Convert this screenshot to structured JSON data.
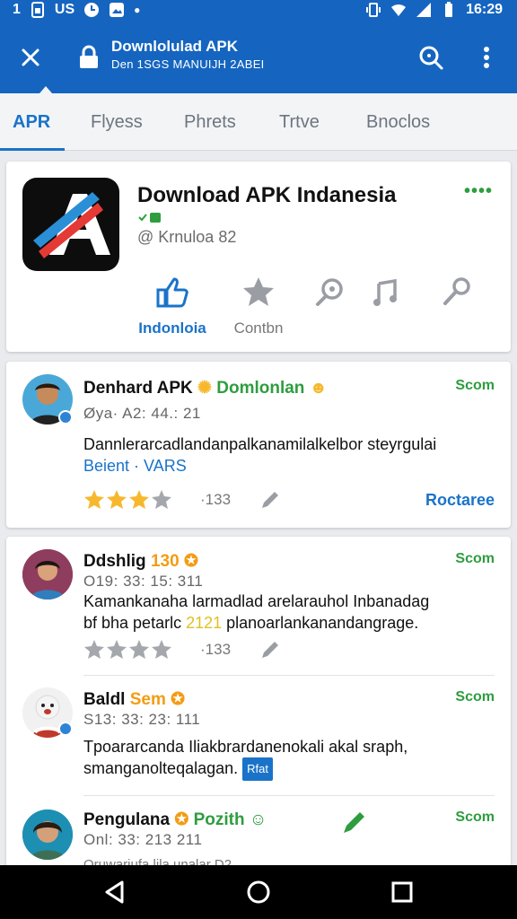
{
  "status_bar": {
    "left_text": "1",
    "left_text2": "US",
    "time": "16:29"
  },
  "app_bar": {
    "title": "Downlolulad APK",
    "subtitle": "Den 1SGS MANUIJH 2ABEI"
  },
  "tabs": [
    {
      "label": "APR",
      "active": true
    },
    {
      "label": "Flyess",
      "active": false
    },
    {
      "label": "Phrets",
      "active": false
    },
    {
      "label": "Trtve",
      "active": false
    },
    {
      "label": "Bnoclos",
      "active": false
    }
  ],
  "app_card": {
    "name": "Download APK Indanesia",
    "author": "@ Krnuloa 82",
    "menu": "••••",
    "actions": [
      {
        "icon": "thumbs-up-icon",
        "label": "Indonloia"
      },
      {
        "icon": "star-icon",
        "label": "Contbn"
      },
      {
        "icon": "search-icon",
        "label": ""
      },
      {
        "icon": "music-note-icon",
        "label": ""
      },
      {
        "icon": "microphone-icon",
        "label": ""
      }
    ]
  },
  "reviews": [
    {
      "name": "Denhard APK",
      "tag": "Domlonlan",
      "date": "Øya· A2: 44.: 21",
      "text1": "Dannlerarcadlandanpalkanamilalkelbor steyrgulai",
      "text2": "Beient · VARS",
      "seen": "Scom",
      "rating": 3,
      "count": "·133",
      "action": "Roctaree"
    },
    {
      "name": "Ddshlig",
      "tag": "130",
      "date": "O19: 33: 15: 311",
      "text1": "Kamankanaha larmadlad arelarauhol Inbanadag",
      "text2a": "bf bha petarlc ",
      "text2b": "2121",
      "text2c": " planoarlankanandangrage.",
      "seen": "Scom",
      "rating": 0,
      "count": "·133"
    },
    {
      "name": "Baldl",
      "tag": "Sem",
      "date": "S13: 33: 23: 111",
      "text1": "Tpoararcanda Iliakbrardanenokali akal sraph,",
      "text2": "smanganolteqalagan.",
      "chip": "Rfat",
      "seen": "Scom"
    },
    {
      "name": "Pengulana",
      "tag": "Pozith",
      "date": "Onl: 33: 213 211",
      "text3": "Oruwariufa lila unalar D2",
      "seen": "Scom"
    }
  ],
  "colors": {
    "primary": "#1565c0",
    "accent": "#1a73c8",
    "green": "#2e9d3f",
    "star": "#f7b82e"
  }
}
